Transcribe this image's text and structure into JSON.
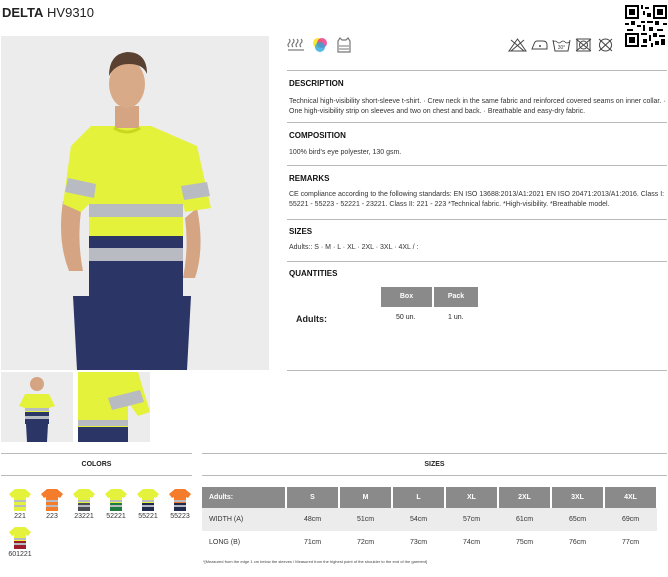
{
  "product": {
    "name": "DELTA",
    "code": "HV9310"
  },
  "icons": {
    "features": [
      "high-visibility-icon",
      "color-palette-icon",
      "vest-standard-icon"
    ],
    "care": [
      "no-bleach-icon",
      "iron-low-icon",
      "wash-30-icon",
      "no-tumble-dry-icon",
      "no-dry-clean-icon"
    ],
    "wash_temp": "30°"
  },
  "sections": {
    "description": {
      "title": "DESCRIPTION",
      "text": "Technical high-visibility short-sleeve t-shirt. · Crew neck in the same fabric and reinforced covered seams on inner collar. · One high-visibility strip on sleeves and two on chest and back. · Breathable and easy-dry fabric."
    },
    "composition": {
      "title": "COMPOSITION",
      "text": "100% bird's eye polyester, 130 gsm."
    },
    "remarks": {
      "title": "REMARKS",
      "text": "CE compliance according to the following standards: EN ISO 13688:2013/A1:2021 EN ISO 20471:2013/A1:2016. Class I: 55221 - 55223 - 52221 - 23221. Class II: 221 - 223 *Technical fabric. *High-visibility. *Breathable model."
    },
    "sizes": {
      "title": "SIZES",
      "text": "Adults:: S · M · L · XL · 2XL · 3XL · 4XL / :"
    },
    "quantities": {
      "title": "QUANTITIES",
      "headers": [
        "Box",
        "Pack"
      ],
      "row_label": "Adults:",
      "values": [
        "50 un.",
        "1 un."
      ]
    }
  },
  "colors": {
    "title": "COLORS",
    "items": [
      {
        "code": "221",
        "top": "#e4f23c",
        "bottom": "#e4f23c"
      },
      {
        "code": "223",
        "top": "#f57c2a",
        "bottom": "#f57c2a"
      },
      {
        "code": "23221",
        "top": "#e4f23c",
        "bottom": "#4a4d52"
      },
      {
        "code": "52221",
        "top": "#e4f23c",
        "bottom": "#1f7a3d"
      },
      {
        "code": "55221",
        "top": "#e4f23c",
        "bottom": "#1f2a4f"
      },
      {
        "code": "55223",
        "top": "#f57c2a",
        "bottom": "#1f2a4f"
      },
      {
        "code": "601221",
        "top": "#e4f23c",
        "bottom": "#9b1c2c"
      }
    ]
  },
  "size_table": {
    "title": "SIZES",
    "headers": [
      "Adults:",
      "S",
      "M",
      "L",
      "XL",
      "2XL",
      "3XL",
      "4XL"
    ],
    "rows": [
      {
        "label": "WIDTH (A)",
        "values": [
          "48cm",
          "51cm",
          "54cm",
          "57cm",
          "61cm",
          "65cm",
          "69cm"
        ]
      },
      {
        "label": "LONG (B)",
        "values": [
          "71cm",
          "72cm",
          "73cm",
          "74cm",
          "75cm",
          "76cm",
          "77cm"
        ]
      }
    ],
    "footnote": "*[Measured from the edge 1 cm below the sleeves / Measured from the highest point of the shoulder to the end of the garment]"
  },
  "palette": {
    "hivis_yellow": "#e4f23c",
    "navy": "#2b3566",
    "reflective": "#b8bcc2",
    "header_grey": "#8a8a8a"
  }
}
